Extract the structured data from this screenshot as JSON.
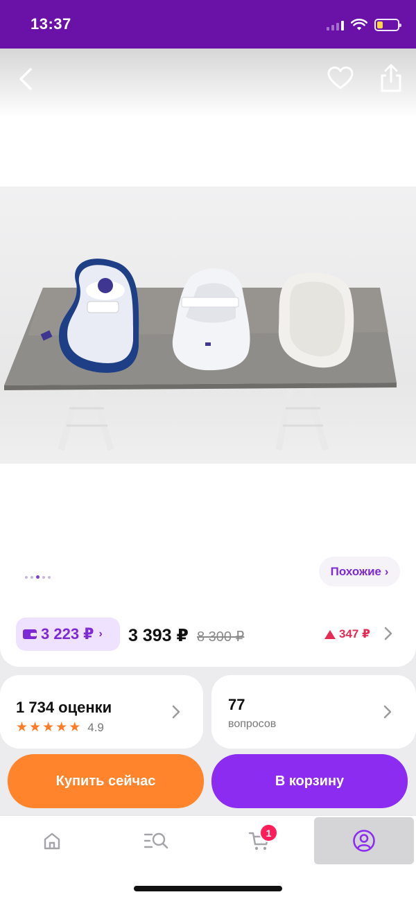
{
  "status_bar": {
    "time": "13:37"
  },
  "gallery": {
    "photo_alt": "product-photo",
    "pages": 4,
    "active_page": 3,
    "similar_label": "Похожие ›"
  },
  "price": {
    "wallet_price": "3 223 ₽",
    "price": "3 393 ₽",
    "old_price": "8 300 ₽",
    "drop": "347 ₽"
  },
  "rating": {
    "title": "1 734 оценки",
    "value": "4.9",
    "stars": 5
  },
  "questions": {
    "count": "77",
    "label": "вопросов"
  },
  "actions": {
    "buy_now": "Купить сейчас",
    "add_to_cart": "В корзину"
  },
  "tab_bar": {
    "cart_badge": "1",
    "icons": [
      "home-icon",
      "catalog-search-icon",
      "cart-icon",
      "profile-icon"
    ]
  },
  "colors": {
    "brand_purple": "#6a12a8",
    "accent_purple": "#8b2cf0",
    "orange": "#ff842c",
    "price_drop_red": "#e62c55"
  }
}
